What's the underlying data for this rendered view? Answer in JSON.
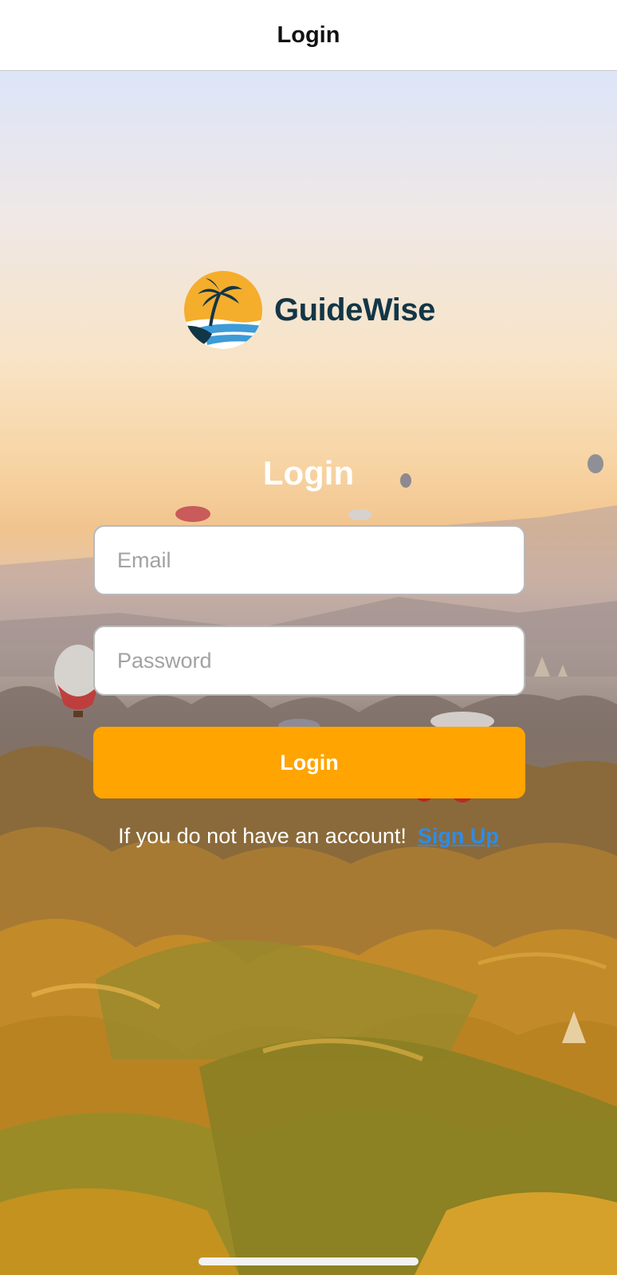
{
  "navbar": {
    "title": "Login"
  },
  "logo": {
    "text": "GuideWise",
    "icon": "palm-sunset-icon"
  },
  "form": {
    "heading": "Login",
    "email_placeholder": "Email",
    "password_placeholder": "Password",
    "login_button_label": "Login"
  },
  "signup": {
    "prompt": "If you do not have an account!",
    "link_label": "Sign Up"
  },
  "colors": {
    "accent": "#ffa400",
    "link": "#2d8ce8",
    "brand_text": "#133646"
  }
}
